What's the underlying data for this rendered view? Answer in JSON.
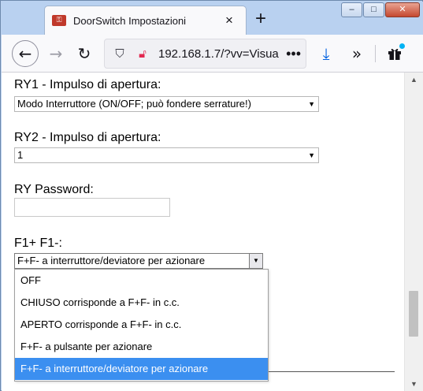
{
  "window": {
    "tab_title": "DoorSwitch Impostazioni",
    "favicon": "key-icon",
    "tab_close": "×",
    "new_tab": "+",
    "min": "‒",
    "max": "□",
    "close": "✕"
  },
  "toolbar": {
    "back": "←",
    "forward": "→",
    "reload": "↻",
    "url": "192.168.1.7/?vv=Visua",
    "url_more": "•••",
    "download": "⤓",
    "overflow": "»",
    "extensions": "gift-icon"
  },
  "form": {
    "ry1_label": "RY1 - Impulso di apertura:",
    "ry1_value": "Modo Interruttore (ON/OFF; può fondere serrature!)",
    "ry2_label": "RY2 - Impulso di apertura:",
    "ry2_value": "1",
    "ry_password_label": "RY Password:",
    "ry_password_value": "",
    "f1_label": "F1+ F1-:",
    "f1_value": "F+F- a interruttore/deviatore per azionare",
    "f1_options": [
      "OFF",
      "CHIUSO corrisponde a F+F- in c.c.",
      "APERTO corrisponde a F+F- in c.c.",
      "F+F- a pulsante per azionare",
      "F+F- a interruttore/deviatore per azionare"
    ],
    "f1_selected_index": 4
  },
  "scrollbar": {
    "up": "▲",
    "down": "▼"
  },
  "colors": {
    "selection": "#3b8ff0",
    "titlebar": "#b9d1f0",
    "toolbar": "#f9f9fb",
    "download_accent": "#0061e0"
  }
}
